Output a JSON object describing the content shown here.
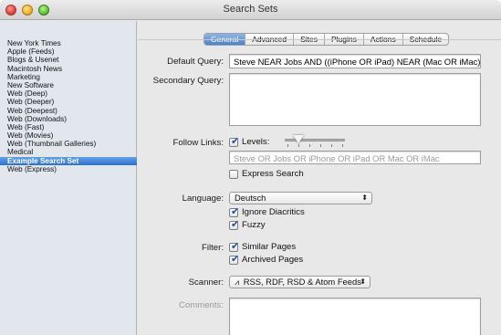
{
  "window": {
    "title": "Search Sets"
  },
  "sidebar": {
    "items": [
      {
        "label": "New York Times",
        "selected": false
      },
      {
        "label": "Apple (Feeds)",
        "selected": false
      },
      {
        "label": "Blogs & Usenet",
        "selected": false
      },
      {
        "label": "Macintosh News",
        "selected": false
      },
      {
        "label": "Marketing",
        "selected": false
      },
      {
        "label": "New Software",
        "selected": false
      },
      {
        "label": "Web (Deep)",
        "selected": false
      },
      {
        "label": "Web (Deeper)",
        "selected": false
      },
      {
        "label": "Web (Deepest)",
        "selected": false
      },
      {
        "label": "Web (Downloads)",
        "selected": false
      },
      {
        "label": "Web (Fast)",
        "selected": false
      },
      {
        "label": "Web (Movies)",
        "selected": false
      },
      {
        "label": "Web (Thumbnail Galleries)",
        "selected": false
      },
      {
        "label": "Medical",
        "selected": false
      },
      {
        "label": "Example Search Set",
        "selected": true
      },
      {
        "label": "Web (Express)",
        "selected": false
      }
    ]
  },
  "tabs": [
    {
      "label": "General",
      "active": true
    },
    {
      "label": "Advanced",
      "active": false
    },
    {
      "label": "Sites",
      "active": false
    },
    {
      "label": "Plugins",
      "active": false
    },
    {
      "label": "Actions",
      "active": false
    },
    {
      "label": "Schedule",
      "active": false
    }
  ],
  "form": {
    "default_query_label": "Default Query:",
    "default_query_value": "Steve NEAR Jobs AND ((iPhone OR iPad) NEAR (Mac OR iMac))",
    "secondary_query_label": "Secondary Query:",
    "secondary_query_value": "",
    "follow_links_label": "Follow Links:",
    "levels_label": "Levels:",
    "levels_checked": true,
    "levels_slider_value": 2,
    "levels_slider_steps": 6,
    "follow_links_field_placeholder": "Steve OR Jobs OR iPhone OR iPad OR Mac OR iMac",
    "express_search_label": "Express Search",
    "express_search_checked": false,
    "language_label": "Language:",
    "language_value": "Deutsch",
    "ignore_diacritics_label": "Ignore Diacritics",
    "ignore_diacritics_checked": true,
    "fuzzy_label": "Fuzzy",
    "fuzzy_checked": true,
    "filter_label": "Filter:",
    "similar_pages_label": "Similar Pages",
    "similar_pages_checked": true,
    "archived_pages_label": "Archived Pages",
    "archived_pages_checked": true,
    "scanner_label": "Scanner:",
    "scanner_value": "RSS, RDF, RSD & Atom Feeds",
    "comments_label": "Comments:",
    "comments_value": ""
  },
  "icons": {
    "check": "✔",
    "popup_arrows": "⬍",
    "rss": "rss-icon"
  },
  "colors": {
    "selection": "#2c6fd1",
    "tab_active": "#4b82cc"
  }
}
